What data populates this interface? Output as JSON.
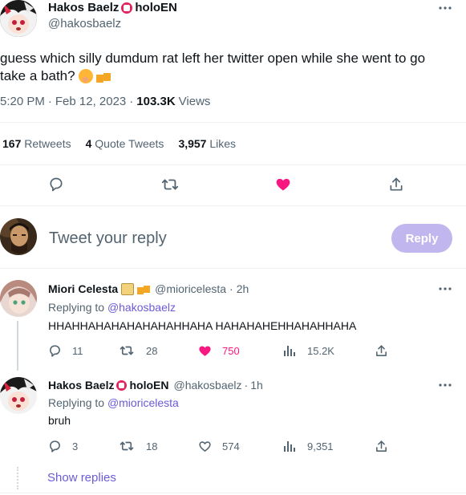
{
  "main_tweet": {
    "display_name": "Hakos Baelz",
    "name_suffix": "holoEN",
    "handle": "@hakosbaelz",
    "text_line1": "guess which silly dumdum rat left her twitter open while she went to go",
    "text_line2": "take a bath?",
    "time": "5:20 PM",
    "date": "Feb 12, 2023",
    "views_count": "103.3K",
    "views_label": "Views",
    "retweets_count": "167",
    "retweets_label": "Retweets",
    "quotes_count": "4",
    "quotes_label": "Quote Tweets",
    "likes_count": "3,957",
    "likes_label": "Likes"
  },
  "composer": {
    "placeholder": "Tweet your reply",
    "reply_label": "Reply"
  },
  "replies": [
    {
      "display_name": "Miori Celesta",
      "handle": "@mioricelesta",
      "age": "2h",
      "replying_to_label": "Replying to",
      "replying_to": "@hakosbaelz",
      "text": "HHAHHAHAHAHAHAHAHHAHA HAHAHAHEHHAHAHHAHA",
      "replies": "11",
      "retweets": "28",
      "likes": "750",
      "views": "15.2K"
    },
    {
      "display_name": "Hakos Baelz",
      "name_suffix": "holoEN",
      "handle": "@hakosbaelz",
      "age": "1h",
      "replying_to_label": "Replying to",
      "replying_to": "@mioricelesta",
      "text": "bruh",
      "replies": "3",
      "retweets": "18",
      "likes": "574",
      "views": "9,351"
    }
  ],
  "show_replies_label": "Show replies",
  "colors": {
    "like_active": "#f91880",
    "link": "#6b5bd6",
    "reply_button": "#c2b6ee",
    "muted": "#536471"
  },
  "icons": [
    "more-icon",
    "reply-icon",
    "retweet-icon",
    "like-icon",
    "share-icon",
    "views-icon"
  ]
}
